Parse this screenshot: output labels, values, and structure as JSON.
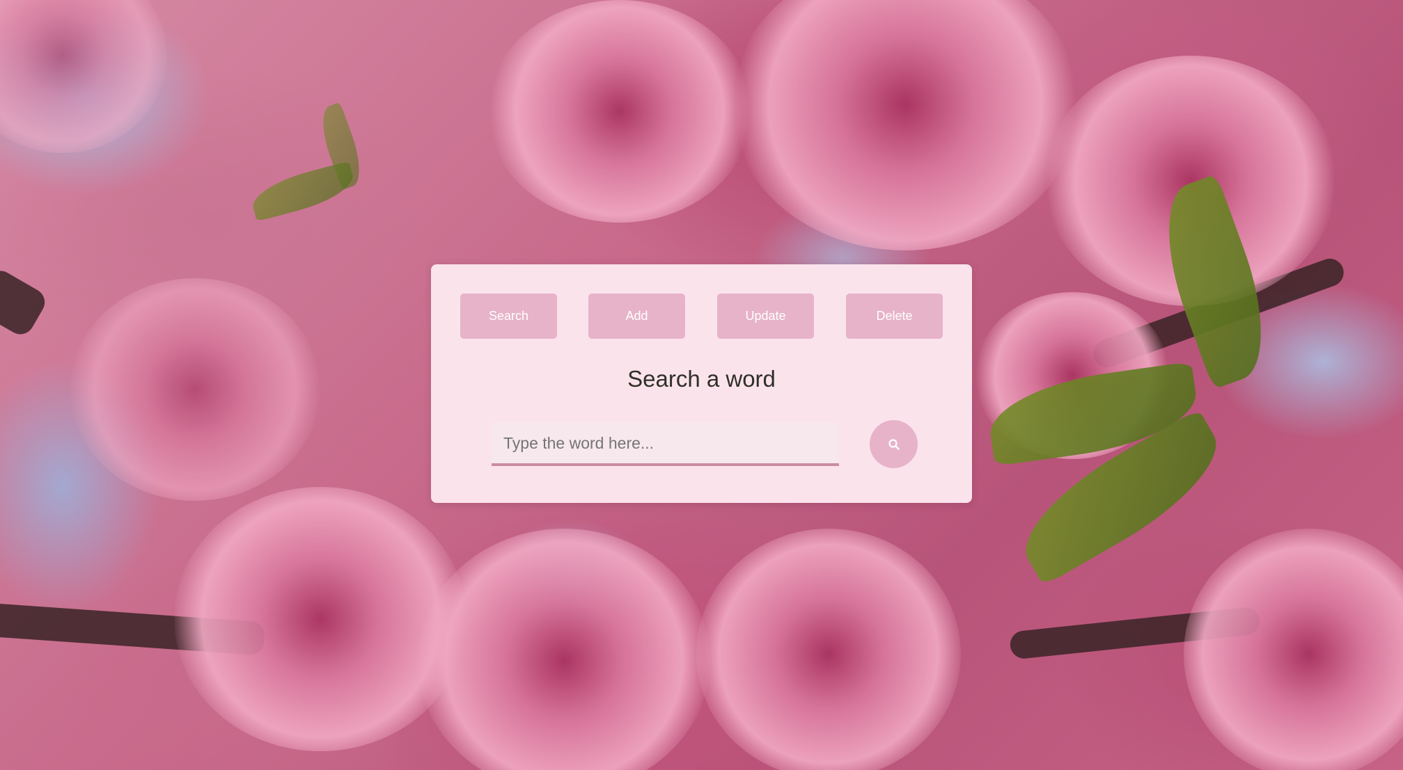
{
  "nav": {
    "buttons": [
      {
        "label": "Search"
      },
      {
        "label": "Add"
      },
      {
        "label": "Update"
      },
      {
        "label": "Delete"
      }
    ]
  },
  "panel": {
    "title": "Search a word"
  },
  "search": {
    "value": "",
    "placeholder": "Type the word here...",
    "submit_icon": "search-icon"
  },
  "colors": {
    "card_background": "#fbe3ec",
    "button_background": "#e7b3c8",
    "button_text": "#ffffff",
    "heading_text": "#2f2f28",
    "input_underline": "#c98ca2"
  },
  "background": {
    "description_icon": "cherry-blossom-photo"
  }
}
